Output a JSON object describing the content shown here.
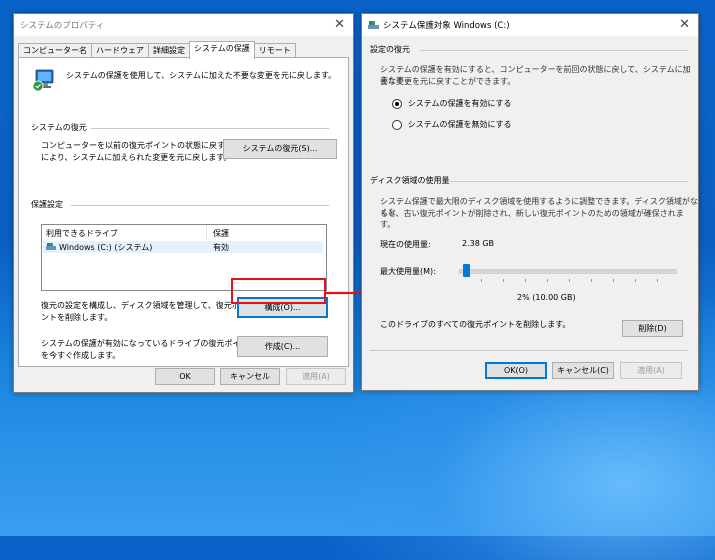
{
  "left_window": {
    "title": "システムのプロパティ",
    "tabs": [
      "コンピューター名",
      "ハードウェア",
      "詳細設定",
      "システムの保護",
      "リモート"
    ],
    "description": "システムの保護を使用して、システムに加えた不要な変更を元に戻します。",
    "restore_section": {
      "heading": "システムの復元",
      "text_line1": "コンピューターを以前の復元ポイントの状態に戻すこと",
      "text_line2": "により、システムに加えられた変更を元に戻します。",
      "button": "システムの復元(S)..."
    },
    "protection_section": {
      "heading": "保護設定",
      "columns": [
        "利用できるドライブ",
        "保護"
      ],
      "rows": [
        {
          "drive": "Windows (C:) (システム)",
          "status": "有効"
        }
      ]
    },
    "configure": {
      "text_line1": "復元の設定を構成し、ディスク領域を管理して、復元ポイ",
      "text_line2": "ントを削除します。",
      "button": "構成(O)..."
    },
    "create": {
      "text_line1": "システムの保護が有効になっているドライブの復元ポイント",
      "text_line2": "を今すぐ作成します。",
      "button": "作成(C)..."
    },
    "footer": {
      "ok": "OK",
      "cancel": "キャンセル",
      "apply": "適用(A)"
    }
  },
  "right_window": {
    "title": "システム保護対象 Windows (C:)",
    "restore_settings": {
      "heading": "設定の復元",
      "text_line1": "システムの保護を有効にすると、コンピューターを前回の状態に戻して、システムに加えた不",
      "text_line2": "要な変更を元に戻すことができます。",
      "options": [
        "システムの保護を有効にする",
        "システムの保護を無効にする"
      ],
      "selected_index": 0
    },
    "disk_usage": {
      "heading": "ディスク領域の使用量",
      "text_line1": "システム保護で最大限のディスク領域を使用するように調整できます。ディスク領域がなくな",
      "text_line2": "ると、古い復元ポイントが削除され、新しい復元ポイントのための領域が確保されます。",
      "current_label": "現在の使用量:",
      "current_value": "2.38 GB",
      "max_label": "最大使用量(M):",
      "slider_fraction": 0.02,
      "slider_readout": "2% (10.00 GB)",
      "delete_text": "このドライブのすべての復元ポイントを削除します。",
      "delete_button": "削除(D)"
    },
    "footer": {
      "ok": "OK(O)",
      "cancel": "キャンセル(C)",
      "apply": "適用(A)"
    }
  },
  "colors": {
    "arrow": "#e8101a",
    "accent": "#0078d7"
  }
}
